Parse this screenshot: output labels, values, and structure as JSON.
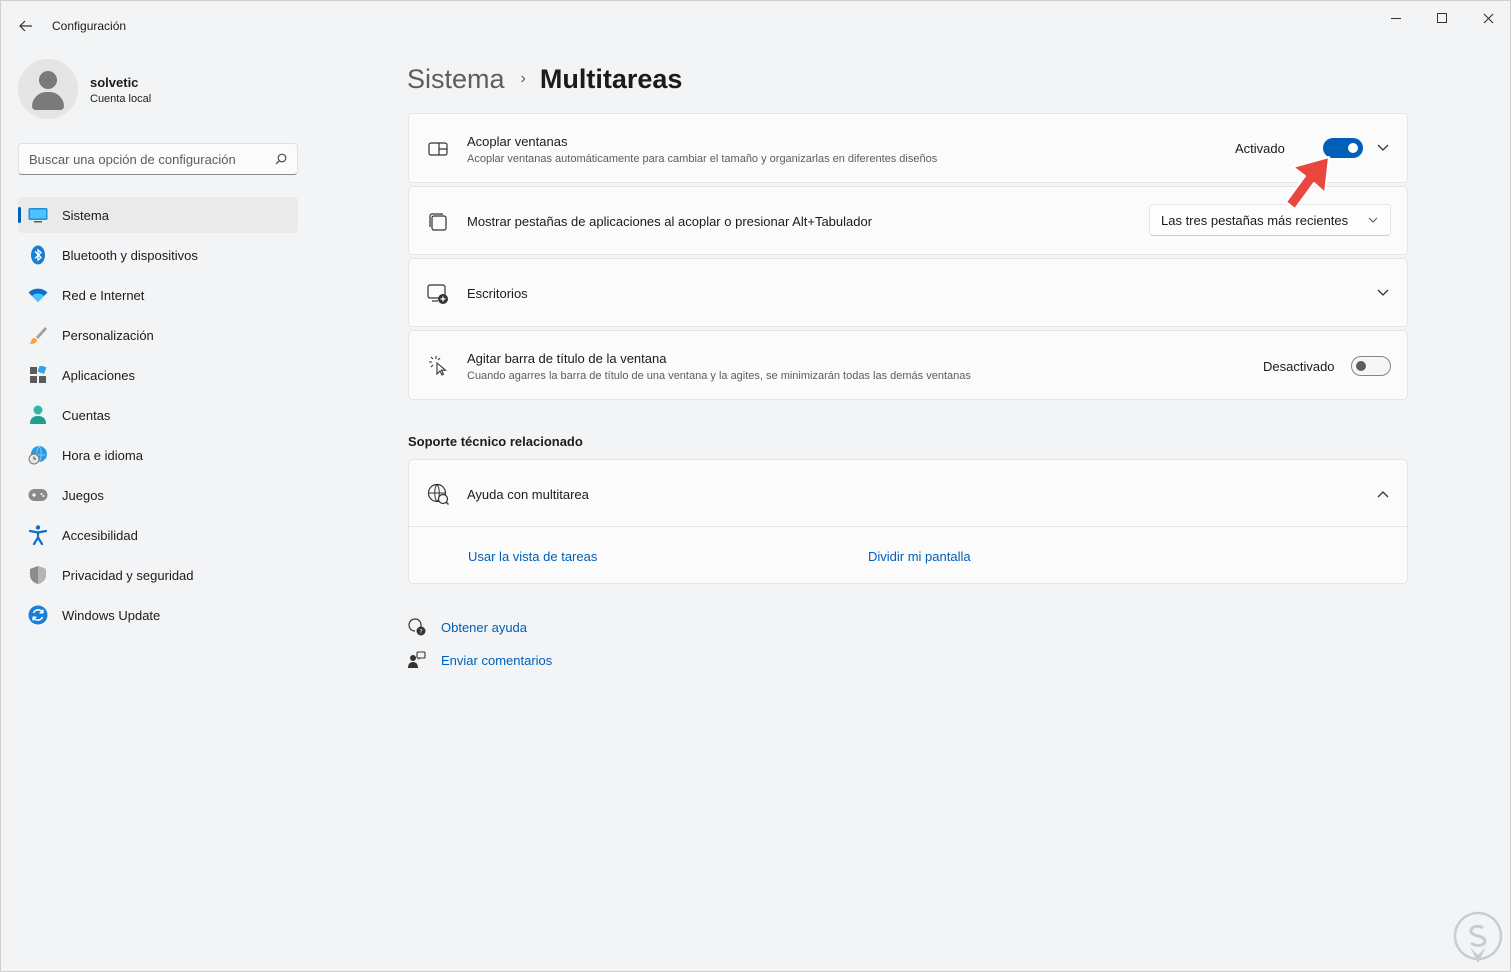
{
  "window": {
    "title": "Configuración"
  },
  "profile": {
    "name": "solvetic",
    "account_type": "Cuenta local"
  },
  "search": {
    "placeholder": "Buscar una opción de configuración"
  },
  "sidebar": {
    "items": [
      {
        "label": "Sistema",
        "icon": "monitor-icon",
        "active": true
      },
      {
        "label": "Bluetooth y dispositivos",
        "icon": "bluetooth-icon"
      },
      {
        "label": "Red e Internet",
        "icon": "wifi-icon"
      },
      {
        "label": "Personalización",
        "icon": "brush-icon"
      },
      {
        "label": "Aplicaciones",
        "icon": "apps-icon"
      },
      {
        "label": "Cuentas",
        "icon": "person-icon"
      },
      {
        "label": "Hora e idioma",
        "icon": "clock-globe-icon"
      },
      {
        "label": "Juegos",
        "icon": "gamepad-icon"
      },
      {
        "label": "Accesibilidad",
        "icon": "accessibility-icon"
      },
      {
        "label": "Privacidad y seguridad",
        "icon": "shield-icon"
      },
      {
        "label": "Windows Update",
        "icon": "update-icon"
      }
    ]
  },
  "breadcrumb": {
    "parent": "Sistema",
    "separator": "›",
    "current": "Multitareas"
  },
  "settings": {
    "snap": {
      "title": "Acoplar ventanas",
      "description": "Acoplar ventanas automáticamente para cambiar el tamaño y organizarlas en diferentes diseños",
      "state_label": "Activado",
      "enabled": true
    },
    "alt_tab": {
      "title": "Mostrar pestañas de aplicaciones al acoplar o presionar Alt+Tabulador",
      "selected_option": "Las tres pestañas más recientes"
    },
    "desktops": {
      "title": "Escritorios"
    },
    "shake": {
      "title": "Agitar barra de título de la ventana",
      "description": "Cuando agarres la barra de título de una ventana y la agites, se minimizarán todas las demás ventanas",
      "state_label": "Desactivado",
      "enabled": false
    }
  },
  "support": {
    "section_title": "Soporte técnico relacionado",
    "card_title": "Ayuda con multitarea",
    "links": [
      "Usar la vista de tareas",
      "Dividir mi pantalla"
    ]
  },
  "footer": {
    "get_help": "Obtener ayuda",
    "feedback": "Enviar comentarios"
  },
  "colors": {
    "accent": "#005fb8",
    "annotation_arrow": "#e8463f"
  }
}
